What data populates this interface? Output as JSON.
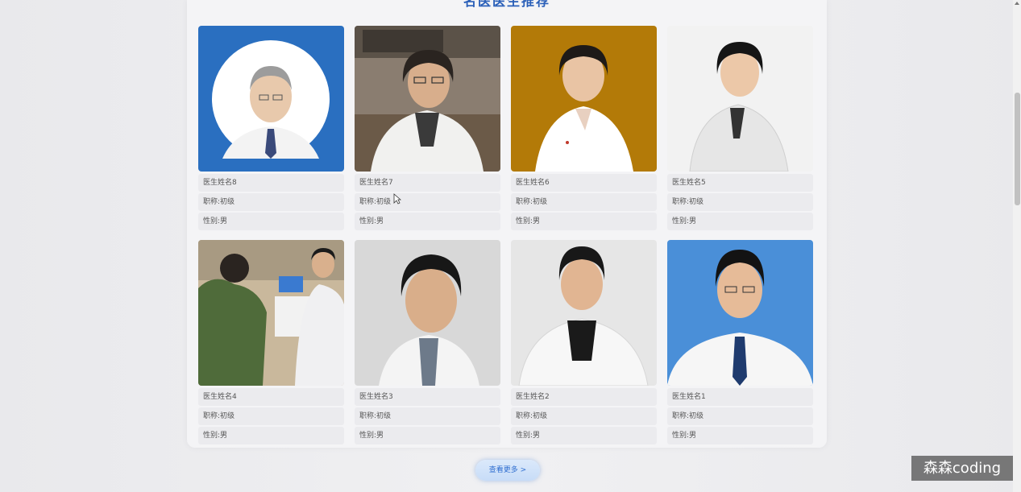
{
  "section": {
    "title": "名医医生推荐"
  },
  "doctors": [
    {
      "name": "医生姓名8",
      "title": "职称:初级",
      "gender": "性别:男",
      "photo_bg": "#2a6fc0"
    },
    {
      "name": "医生姓名7",
      "title": "职称:初级",
      "gender": "性别:男",
      "photo_bg": "#8a7d70"
    },
    {
      "name": "医生姓名6",
      "title": "职称:初级",
      "gender": "性别:男",
      "photo_bg": "#b37a08"
    },
    {
      "name": "医生姓名5",
      "title": "职称:初级",
      "gender": "性别:男",
      "photo_bg": "#f2f2f2"
    },
    {
      "name": "医生姓名4",
      "title": "职称:初级",
      "gender": "性别:男",
      "photo_bg": "#c9b89c"
    },
    {
      "name": "医生姓名3",
      "title": "职称:初级",
      "gender": "性别:男",
      "photo_bg": "#d8d8d8"
    },
    {
      "name": "医生姓名2",
      "title": "职称:初级",
      "gender": "性别:男",
      "photo_bg": "#e6e6e6"
    },
    {
      "name": "医生姓名1",
      "title": "职称:初级",
      "gender": "性别:男",
      "photo_bg": "#4a8fd8"
    }
  ],
  "more_button": {
    "label": "查看更多 >"
  },
  "watermark": {
    "text": "森森coding"
  }
}
